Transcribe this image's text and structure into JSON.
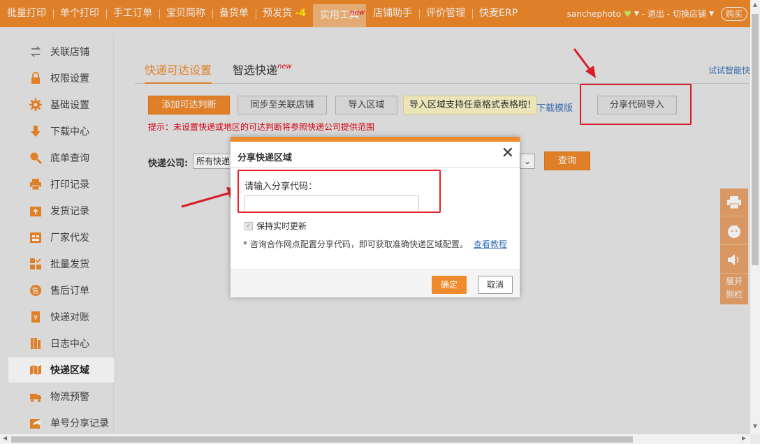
{
  "topnav": {
    "items": [
      {
        "label": "批量打印"
      },
      {
        "label": "单个打印"
      },
      {
        "label": "手工订单"
      },
      {
        "label": "宝贝简称"
      },
      {
        "label": "备货单"
      },
      {
        "label": "预发货",
        "badge": "-4"
      },
      {
        "label": "实用工具",
        "tag": "new"
      },
      {
        "label": "店铺助手"
      },
      {
        "label": "评价管理"
      },
      {
        "label": "快麦ERP"
      }
    ],
    "user": "sanchephoto",
    "logout": "- 退出 -",
    "switch_shop": "切换店铺",
    "buy": "购买"
  },
  "sidebar": {
    "items": [
      {
        "label": "关联店铺",
        "icon": "link-arrows-icon"
      },
      {
        "label": "权限设置",
        "icon": "lock-icon"
      },
      {
        "label": "基础设置",
        "icon": "gear-icon"
      },
      {
        "label": "下载中心",
        "icon": "download-icon"
      },
      {
        "label": "底单查询",
        "icon": "search-icon"
      },
      {
        "label": "打印记录",
        "icon": "printer-icon"
      },
      {
        "label": "发货记录",
        "icon": "upload-box-icon"
      },
      {
        "label": "厂家代发",
        "icon": "factory-icon"
      },
      {
        "label": "批量发货",
        "icon": "batch-ship-icon"
      },
      {
        "label": "售后订单",
        "icon": "aftersale-icon"
      },
      {
        "label": "快递对账",
        "icon": "yen-receipt-icon"
      },
      {
        "label": "日志中心",
        "icon": "log-book-icon"
      },
      {
        "label": "快递区域",
        "icon": "map-region-icon",
        "active": true
      },
      {
        "label": "物流预警",
        "icon": "truck-warning-icon"
      },
      {
        "label": "单号分享记录",
        "icon": "share-icon"
      }
    ]
  },
  "main": {
    "tabs": [
      {
        "label": "快递可达设置"
      },
      {
        "label": "智选快递",
        "tag": "new"
      }
    ],
    "trial_link": "试试智能快",
    "buttons": {
      "add_rule": "添加可达判断",
      "sync": "同步至关联店铺",
      "import_area": "导入区域",
      "share_import": "分享代码导入",
      "query": "查询"
    },
    "import_tip": "导入区域支持任意格式表格啦!",
    "download_template": "下载模版",
    "hint": "提示：未设置快递或地区的可达判断将参照快递公司提供范围",
    "express_label": "快递公司:",
    "express_select": "所有快递"
  },
  "float_bar": {
    "expand_label_1": "展开",
    "expand_label_2": "侧栏"
  },
  "modal": {
    "title": "分享快递区域",
    "input_label": "请输入分享代码：",
    "input_placeholder": "",
    "keep_updated": "保持实时更新",
    "note": "* 咨询合作网点配置分享代码，即可获取准确快递区域配置。",
    "tutorial_link": "查看教程",
    "ok": "确定",
    "cancel": "取消"
  },
  "colors": {
    "accent": "#f08a2d",
    "highlight": "#e8202a",
    "link": "#3a74b8"
  }
}
